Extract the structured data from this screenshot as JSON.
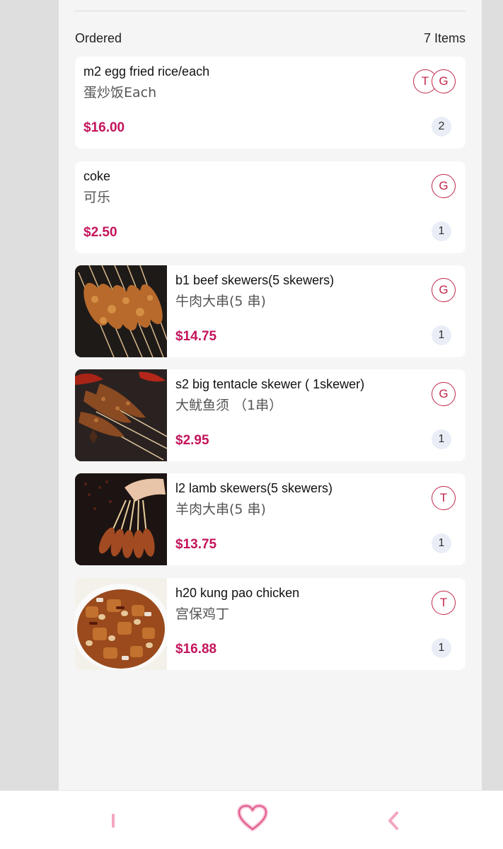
{
  "ordered": {
    "label": "Ordered",
    "count": "7 Items"
  },
  "items": [
    {
      "name": "m2 egg fried rice/each",
      "subname": "蛋炒饭Each",
      "price": "$16.00",
      "badges": [
        "T",
        "G"
      ],
      "qty": "2",
      "image": null
    },
    {
      "name": "coke",
      "subname": "可乐",
      "price": "$2.50",
      "badges": [
        "G"
      ],
      "qty": "1",
      "image": null
    },
    {
      "name": "b1 beef skewers(5 skewers)",
      "subname": "牛肉大串(5 串)",
      "price": "$14.75",
      "badges": [
        "G"
      ],
      "qty": "1",
      "image": "beef-skewers-photo"
    },
    {
      "name": "s2 big tentacle skewer ( 1skewer)",
      "subname": "大鱿鱼须 （1串）",
      "price": "$2.95",
      "badges": [
        "G"
      ],
      "qty": "1",
      "image": "squid-skewer-photo"
    },
    {
      "name": "l2 lamb skewers(5 skewers)",
      "subname": "羊肉大串(5 串)",
      "price": "$13.75",
      "badges": [
        "T"
      ],
      "qty": "1",
      "image": "lamb-skewers-photo"
    },
    {
      "name": "h20 kung pao chicken",
      "subname": "宫保鸡丁",
      "price": "$16.88",
      "badges": [
        "T"
      ],
      "qty": "1",
      "image": "kung-pao-chicken-photo"
    }
  ],
  "bottom_nav": [
    {
      "icon": "menu-bar-icon"
    },
    {
      "icon": "heart-icon"
    },
    {
      "icon": "back-chevron-icon"
    }
  ],
  "colors": {
    "price": "#c4145b",
    "badge": "#c0284c",
    "qty_bg": "#e9edf6",
    "nav": "#f3a6c0"
  }
}
